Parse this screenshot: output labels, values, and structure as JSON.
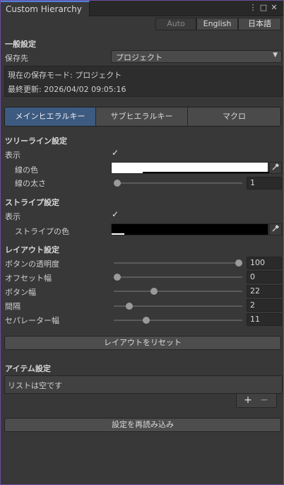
{
  "window": {
    "title": "Custom Hierarchy"
  },
  "window_controls": {
    "menu": "⋮",
    "maximize": "□",
    "close": "✕"
  },
  "language": {
    "auto": "Auto",
    "english": "English",
    "japanese": "日本語"
  },
  "general": {
    "title": "一般設定",
    "save_label": "保存先",
    "save_value": "プロジェクト",
    "mode_text": "現在の保存モード: プロジェクト",
    "updated_text": "最終更新: 2026/04/02 09:05:16"
  },
  "tabs": {
    "main": "メインヒエラルキー",
    "sub": "サブヒエラルキー",
    "macro": "マクロ"
  },
  "treeline": {
    "title": "ツリーライン設定",
    "show_label": "表示",
    "color_label": "線の色",
    "width_label": "線の太さ",
    "width_value": "1",
    "width_fraction": 0
  },
  "stripe": {
    "title": "ストライプ設定",
    "show_label": "表示",
    "color_label": "ストライプの色"
  },
  "layout": {
    "title": "レイアウト設定",
    "opacity_label": "ボタンの透明度",
    "opacity_value": "100",
    "opacity_fraction": 1.0,
    "offset_label": "オフセット幅",
    "offset_value": "0",
    "offset_fraction": 0,
    "buttonwidth_label": "ボタン幅",
    "buttonwidth_value": "22",
    "buttonwidth_fraction": 0.3,
    "spacing_label": "間隔",
    "spacing_value": "2",
    "spacing_fraction": 0.1,
    "separator_label": "セパレーター幅",
    "separator_value": "11",
    "separator_fraction": 0.24,
    "reset_button": "レイアウトをリセット"
  },
  "items": {
    "title": "アイテム設定",
    "empty_text": "リストは空です",
    "add_label": "+",
    "remove_label": "−"
  },
  "reload_button": "設定を再読み込み",
  "icons": {
    "check": "✓",
    "eyedropper": "eyedropper-icon",
    "dropdown": "▼"
  },
  "colors": {
    "accent": "#3d5a80",
    "tab_highlight": "#4f7fd6",
    "line_color": "#ffffff",
    "stripe_color": "#000000"
  }
}
